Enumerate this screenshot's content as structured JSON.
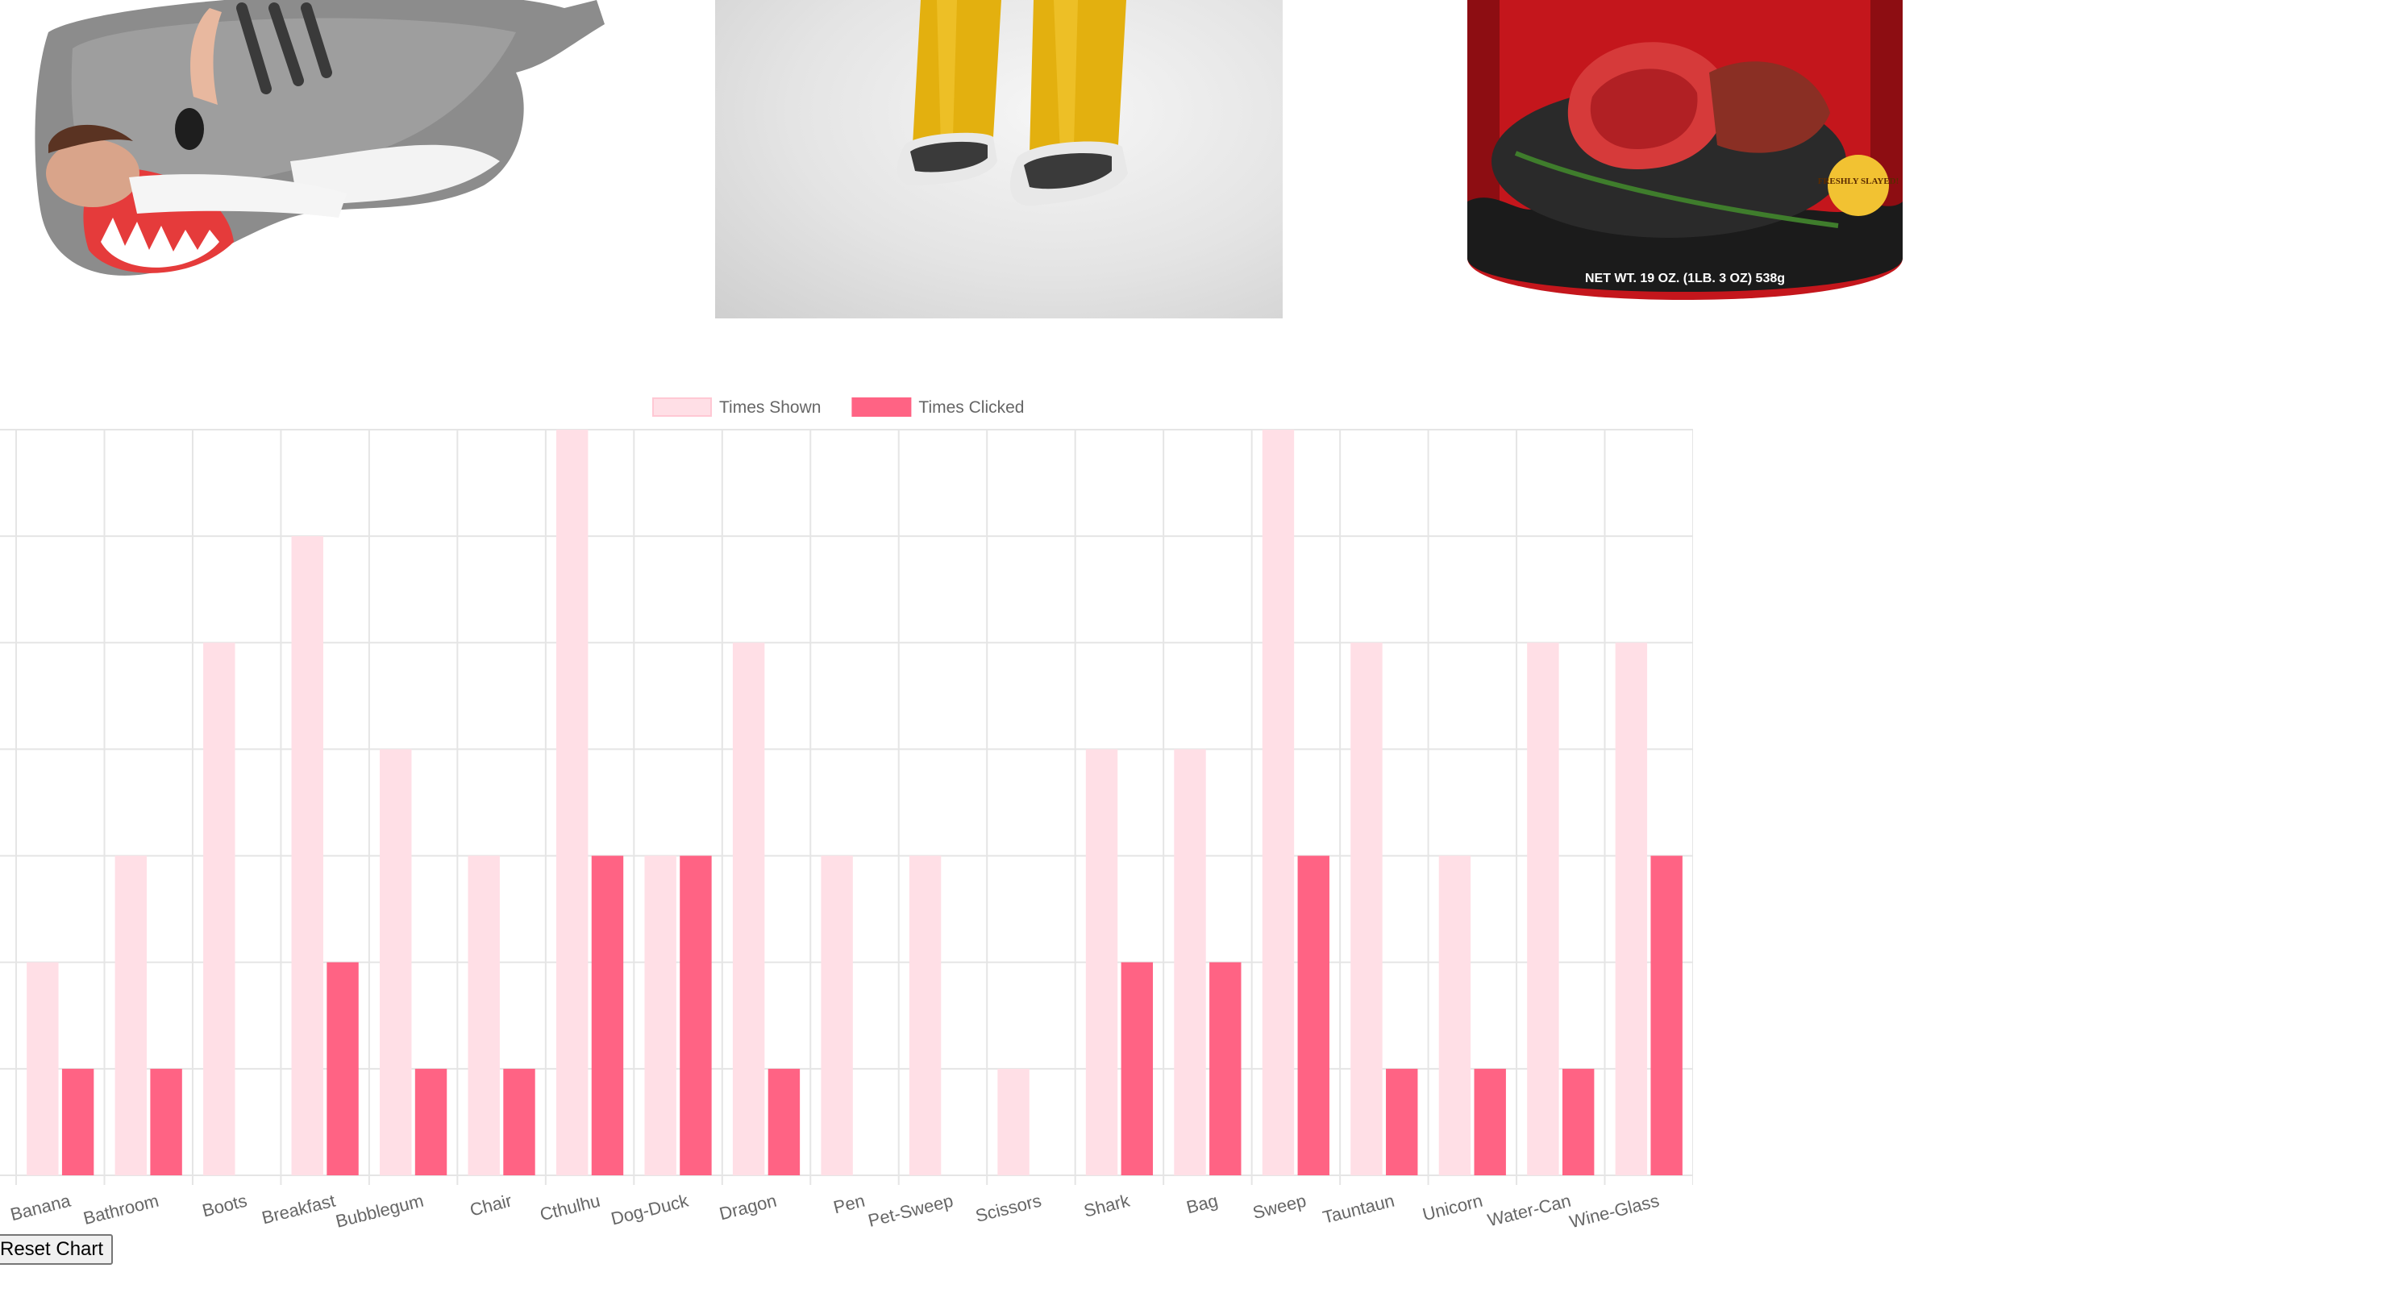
{
  "images": {
    "shark": {
      "alt": "Shark sleeping bag",
      "icon": "shark-sleeping-bag-image"
    },
    "boots": {
      "alt": "Yellow open-toe rain boots",
      "icon": "boots-image"
    },
    "meat": {
      "alt": "Canned dragon meat",
      "icon": "meat-can-image",
      "label_line": "NET WT. 19 OZ. (1LB. 3 OZ) 538g",
      "badge": "FRESHLY SLAYED!"
    }
  },
  "reset_button_label": "Reset Chart",
  "colors": {
    "shown_bar": "#ffdfe6",
    "clicked_bar": "#ff6384",
    "grid": "#e5e5e5",
    "text": "#666666"
  },
  "chart_data": {
    "type": "bar",
    "categories": [
      "Banana",
      "Bathroom",
      "Boots",
      "Breakfast",
      "Bubblegum",
      "Chair",
      "Cthulhu",
      "Dog-Duck",
      "Dragon",
      "Pen",
      "Pet-Sweep",
      "Scissors",
      "Shark",
      "Bag",
      "Sweep",
      "Tauntaun",
      "Unicorn",
      "Water-Can",
      "Wine-Glass"
    ],
    "series": [
      {
        "name": "Times Shown",
        "values": [
          2,
          3,
          5,
          6,
          4,
          3,
          7,
          3,
          5,
          3,
          3,
          1,
          4,
          4,
          7,
          5,
          3,
          5,
          5
        ]
      },
      {
        "name": "Times Clicked",
        "values": [
          1,
          1,
          0,
          2,
          1,
          1,
          3,
          3,
          1,
          0,
          0,
          0,
          2,
          2,
          3,
          1,
          1,
          1,
          3
        ]
      }
    ],
    "ylim": [
      0,
      7
    ],
    "grid": true,
    "legend": "top",
    "title": "",
    "xlabel": "",
    "ylabel": ""
  }
}
